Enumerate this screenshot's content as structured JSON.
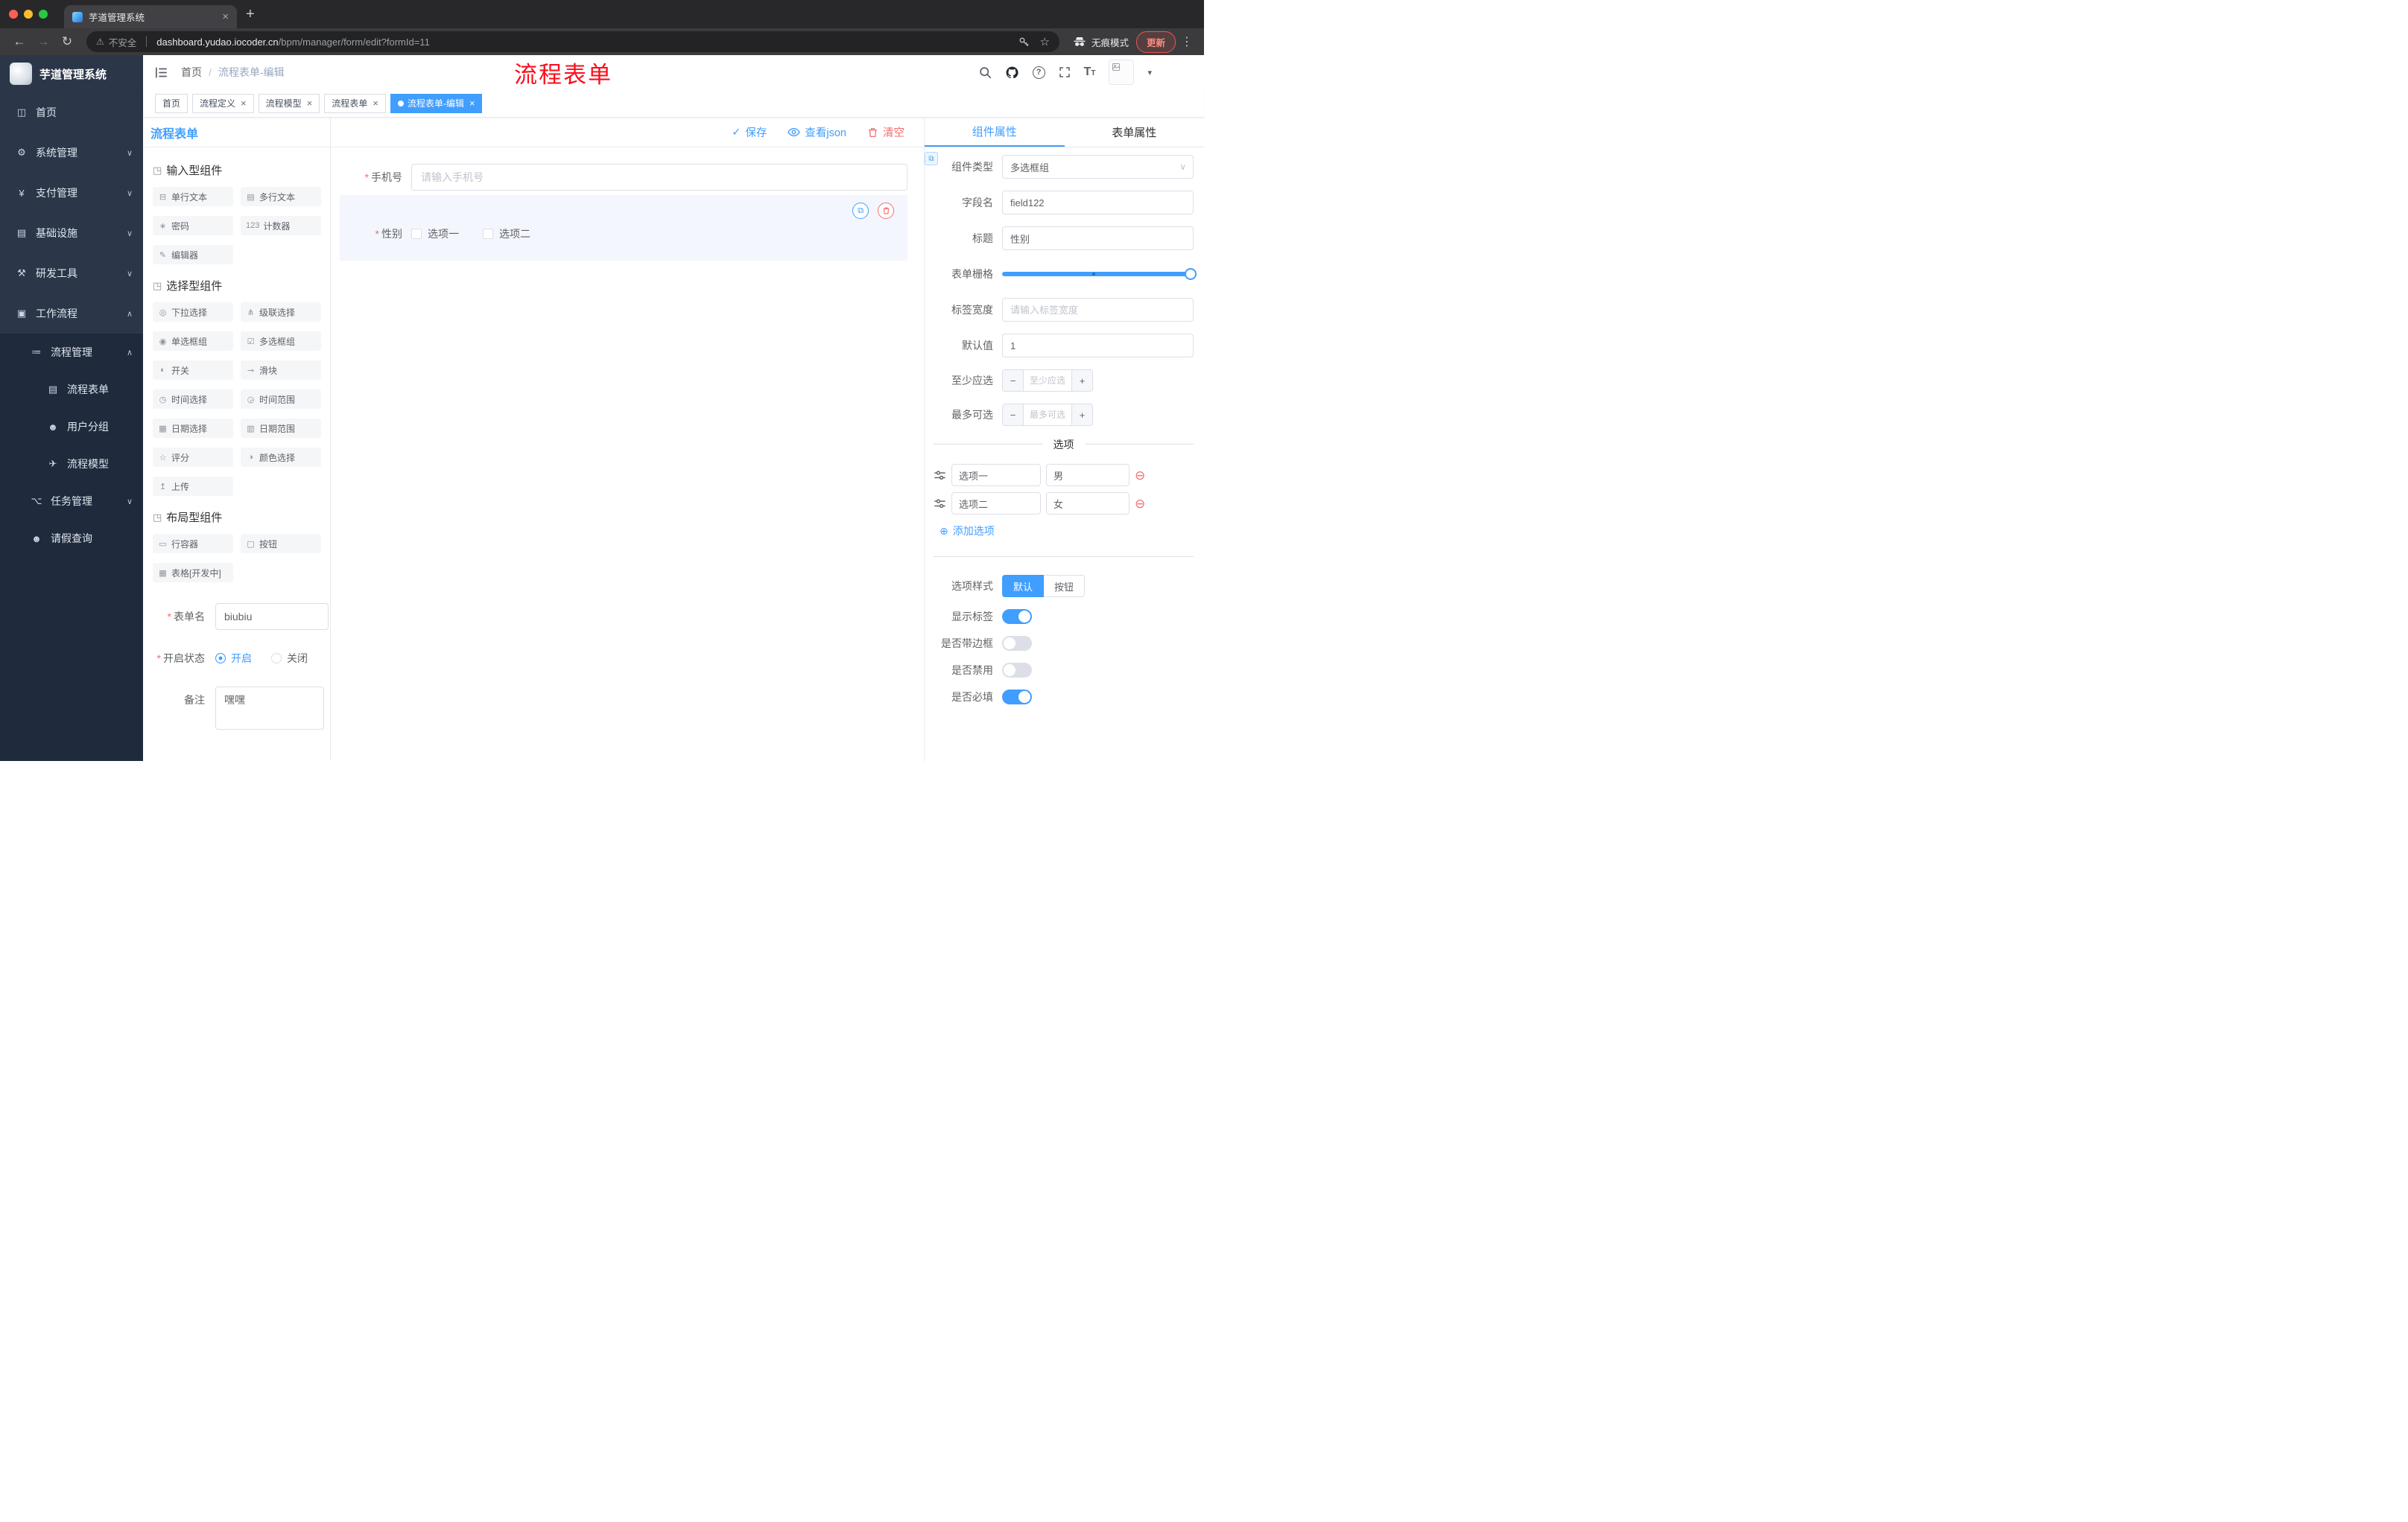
{
  "colors": {
    "accent": "#409eff",
    "danger": "#f56c6c",
    "sidebar": "#1f2a3c"
  },
  "icons": {
    "back": "←",
    "forward": "→",
    "reload": "↻",
    "plus": "+",
    "close": "×",
    "warn": "⚠",
    "star": "☆",
    "dots": "⋮",
    "caret": "▾",
    "chevron_down": "∨",
    "check": "✓",
    "copy": "⧉",
    "link": "⧉",
    "add": "⊕",
    "remove": "⊖",
    "minus": "−",
    "asterisk": "*",
    "dot": "●",
    "question": "?",
    "t_large": "T",
    "t_small": "T"
  },
  "browser": {
    "tab_title": "芋道管理系统",
    "security_label": "不安全",
    "url_domain": "dashboard.yudao.iocoder.cn",
    "url_path": "/bpm/manager/form/edit?formId=11",
    "incognito_label": "无痕模式",
    "update_label": "更新"
  },
  "sidebar": {
    "logo_title": "芋道管理系统",
    "menu": [
      {
        "icon": "◫",
        "label": "首页",
        "chevron": ""
      },
      {
        "icon": "⚙",
        "label": "系统管理",
        "chevron": "∨"
      },
      {
        "icon": "¥",
        "label": "支付管理",
        "chevron": "∨"
      },
      {
        "icon": "▤",
        "label": "基础设施",
        "chevron": "∨"
      },
      {
        "icon": "⚒",
        "label": "研发工具",
        "chevron": "∨"
      },
      {
        "icon": "▣",
        "label": "工作流程",
        "chevron": "∧"
      },
      {
        "icon": "≔",
        "label": "流程管理",
        "chevron": "∧"
      },
      {
        "icon": "▤",
        "label": "流程表单",
        "chevron": ""
      },
      {
        "icon": "☻",
        "label": "用户分组",
        "chevron": ""
      },
      {
        "icon": "✈",
        "label": "流程模型",
        "chevron": ""
      },
      {
        "icon": "⌥",
        "label": "任务管理",
        "chevron": "∨"
      },
      {
        "icon": "☻",
        "label": "请假查询",
        "chevron": ""
      }
    ]
  },
  "header": {
    "breadcrumb_home": "首页",
    "breadcrumb_sep": "/",
    "breadcrumb_current": "流程表单-编辑",
    "annotation": "流程表单"
  },
  "tags": [
    {
      "label": "首页"
    },
    {
      "label": "流程定义"
    },
    {
      "label": "流程模型"
    },
    {
      "label": "流程表单"
    },
    {
      "label": "流程表单-编辑"
    }
  ],
  "palette": {
    "panel_title": "流程表单",
    "sections": [
      {
        "icon": "◳",
        "title": "输入型组件",
        "items": [
          {
            "icon": "⊟",
            "label": "单行文本"
          },
          {
            "icon": "▤",
            "label": "多行文本"
          },
          {
            "icon": "∗",
            "label": "密码"
          },
          {
            "icon": "123",
            "label": "计数器"
          },
          {
            "icon": "✎",
            "label": "编辑器"
          }
        ]
      },
      {
        "icon": "◳",
        "title": "选择型组件",
        "items": [
          {
            "icon": "◎",
            "label": "下拉选择"
          },
          {
            "icon": "⋔",
            "label": "级联选择"
          },
          {
            "icon": "◉",
            "label": "单选框组"
          },
          {
            "icon": "☑",
            "label": "多选框组"
          },
          {
            "icon": "◐",
            "label": "开关"
          },
          {
            "icon": "⊸",
            "label": "滑块"
          },
          {
            "icon": "◷",
            "label": "时间选择"
          },
          {
            "icon": "◶",
            "label": "时间范围"
          },
          {
            "icon": "▦",
            "label": "日期选择"
          },
          {
            "icon": "▥",
            "label": "日期范围"
          },
          {
            "icon": "☆",
            "label": "评分"
          },
          {
            "icon": "◑",
            "label": "颜色选择"
          },
          {
            "icon": "↥",
            "label": "上传"
          }
        ]
      },
      {
        "icon": "◳",
        "title": "布局型组件",
        "items": [
          {
            "icon": "▭",
            "label": "行容器"
          },
          {
            "icon": "▢",
            "label": "按钮"
          },
          {
            "icon": "▦",
            "label": "表格[开发中]"
          }
        ]
      }
    ],
    "form": {
      "name_label": "表单名",
      "name_value": "biubiu",
      "status_label": "开启状态",
      "status_on": "开启",
      "status_off": "关闭",
      "remark_label": "备注",
      "remark_value": "嘿嘿"
    }
  },
  "canvas": {
    "toolbar": {
      "save": "保存",
      "view_json": "查看json",
      "clear": "清空"
    },
    "phone_label": "手机号",
    "phone_placeholder": "请输入手机号",
    "gender_label": "性别",
    "gender_option1": "选项一",
    "gender_option2": "选项二"
  },
  "props": {
    "tab_component": "组件属性",
    "tab_form": "表单属性",
    "component_type_label": "组件类型",
    "component_type_value": "多选框组",
    "field_name_label": "字段名",
    "field_name_value": "field122",
    "title_label": "标题",
    "title_value": "性别",
    "grid_label": "表单栅格",
    "label_width_label": "标签宽度",
    "label_width_placeholder": "请输入标签宽度",
    "default_label": "默认值",
    "default_value": "1",
    "min_label": "至少应选",
    "min_placeholder": "至少应选",
    "max_label": "最多可选",
    "max_placeholder": "最多可选",
    "options_title": "选项",
    "options": [
      {
        "label": "选项一",
        "value": "男"
      },
      {
        "label": "选项二",
        "value": "女"
      }
    ],
    "add_option": "添加选项",
    "option_style_label": "选项样式",
    "option_style_default": "默认",
    "option_style_button": "按钮",
    "show_label_label": "显示标签",
    "border_label": "是否带边框",
    "disabled_label": "是否禁用",
    "required_label": "是否必填"
  }
}
